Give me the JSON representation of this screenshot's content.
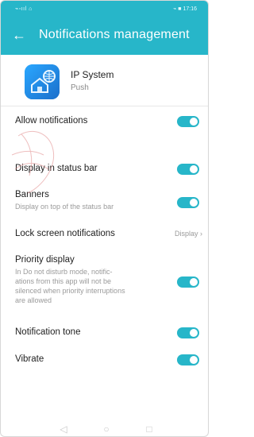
{
  "colors": {
    "accent": "#27b6c9",
    "appIcon": "#1e8fd8"
  },
  "statusbar": {
    "left": "⌁◦ııl ⌂",
    "right": "⌁ ■ 17:16"
  },
  "header": {
    "title": "Notifications management"
  },
  "app": {
    "name": "IP System",
    "subtitle": "Push"
  },
  "settings": [
    {
      "label": "Allow notifications",
      "enabled": true
    },
    {
      "label": "Display in status bar",
      "enabled": true
    },
    {
      "label": "Banners",
      "description": "Display on top of the status bar",
      "enabled": true
    },
    {
      "label": "Lock screen notifications",
      "value": "Display"
    },
    {
      "label": "Priority display",
      "description": "In Do not disturb mode, notific-\nations from this app will not be\nsilenced when priority interruptions\nare allowed",
      "enabled": true
    },
    {
      "label": "Notification tone",
      "enabled": true
    },
    {
      "label": "Vibrate",
      "enabled": true
    }
  ]
}
